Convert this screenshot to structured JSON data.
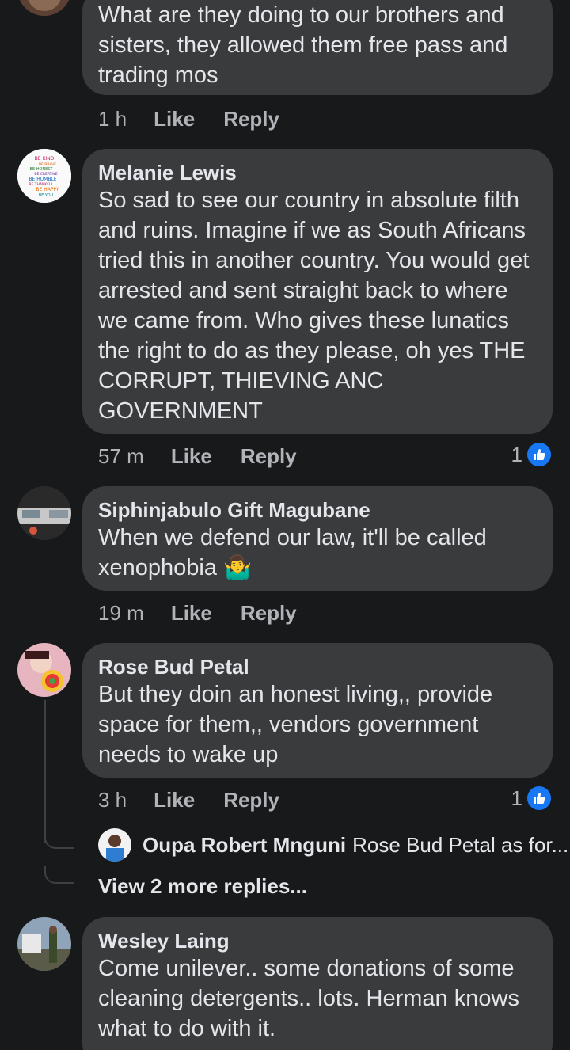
{
  "comments": [
    {
      "author": "",
      "text": "What are they doing to our brothers and sisters, they allowed them free pass and trading mos",
      "time": "1 h",
      "like": "Like",
      "reply": "Reply",
      "reaction_count": ""
    },
    {
      "author": "Melanie Lewis",
      "text": "So sad to see our country in absolute filth and ruins.  Imagine if we as South Africans tried this in another country. You would get arrested and sent straight back to where we came from.  Who gives these lunatics the right to do as they please,  oh yes THE CORRUPT, THIEVING ANC GOVERNMENT",
      "time": "57 m",
      "like": "Like",
      "reply": "Reply",
      "reaction_count": "1"
    },
    {
      "author": "Siphinjabulo Gift Magubane",
      "text": "When we defend our law, it'll be called xenophobia 🤷‍♂️",
      "time": "19 m",
      "like": "Like",
      "reply": "Reply",
      "reaction_count": ""
    },
    {
      "author": "Rose Bud Petal",
      "text": "But they doin an honest living,, provide space for them,, vendors government needs to wake up",
      "time": "3 h",
      "like": "Like",
      "reply": "Reply",
      "reaction_count": "1"
    },
    {
      "author": "Wesley Laing",
      "text": "Come unilever..   some donations of some cleaning  detergents.. lots. Herman knows what to do with it.",
      "time": "",
      "like": "",
      "reply": "",
      "reaction_count": ""
    }
  ],
  "reply_preview": {
    "author": "Oupa Robert Mnguni",
    "text": "Rose Bud Petal as for..."
  },
  "view_more": "View 2 more replies...",
  "avatar_badge_lines": [
    "BE KIND",
    "BE BRAVE",
    "BE HONEST",
    "BE CREATIVE",
    "BE HUMBLE",
    "BE THANKFUL",
    "BE HAPPY",
    "BE YOU"
  ],
  "colors": {
    "background": "#18191a",
    "bubble": "#3a3b3c",
    "text": "#e4e6eb",
    "secondary": "#b0b3b8",
    "like_blue": "#1877f2"
  },
  "icons": {
    "reaction": "like-thumb-icon"
  }
}
